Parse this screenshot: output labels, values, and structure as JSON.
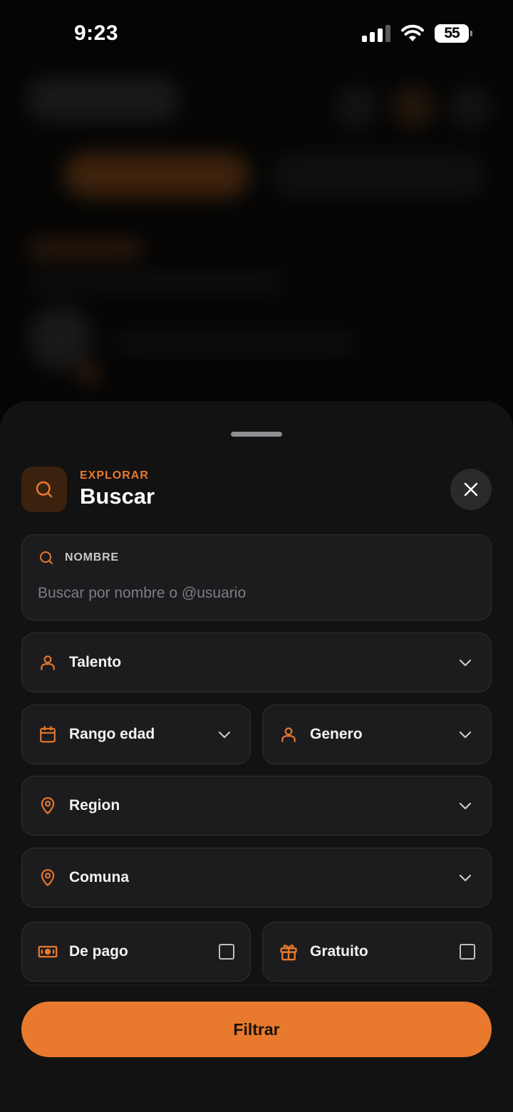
{
  "status_bar": {
    "time": "9:23",
    "battery": "55"
  },
  "header": {
    "eyebrow": "EXPLORAR",
    "title": "Buscar"
  },
  "name_field": {
    "label": "NOMBRE",
    "placeholder": "Buscar por nombre o @usuario",
    "value": ""
  },
  "filters": {
    "talento": "Talento",
    "rango_edad": "Rango edad",
    "genero": "Genero",
    "region": "Region",
    "comuna": "Comuna",
    "de_pago": "De pago",
    "gratuito": "Gratuito"
  },
  "submit_label": "Filtrar",
  "colors": {
    "accent": "#e8792d",
    "sheet_bg": "#121212",
    "field_bg": "#1c1c1e"
  },
  "icons": [
    "search-icon",
    "close-icon",
    "user-icon",
    "calendar-icon",
    "map-pin-icon",
    "banknote-icon",
    "gift-icon",
    "chevron-down-icon"
  ]
}
